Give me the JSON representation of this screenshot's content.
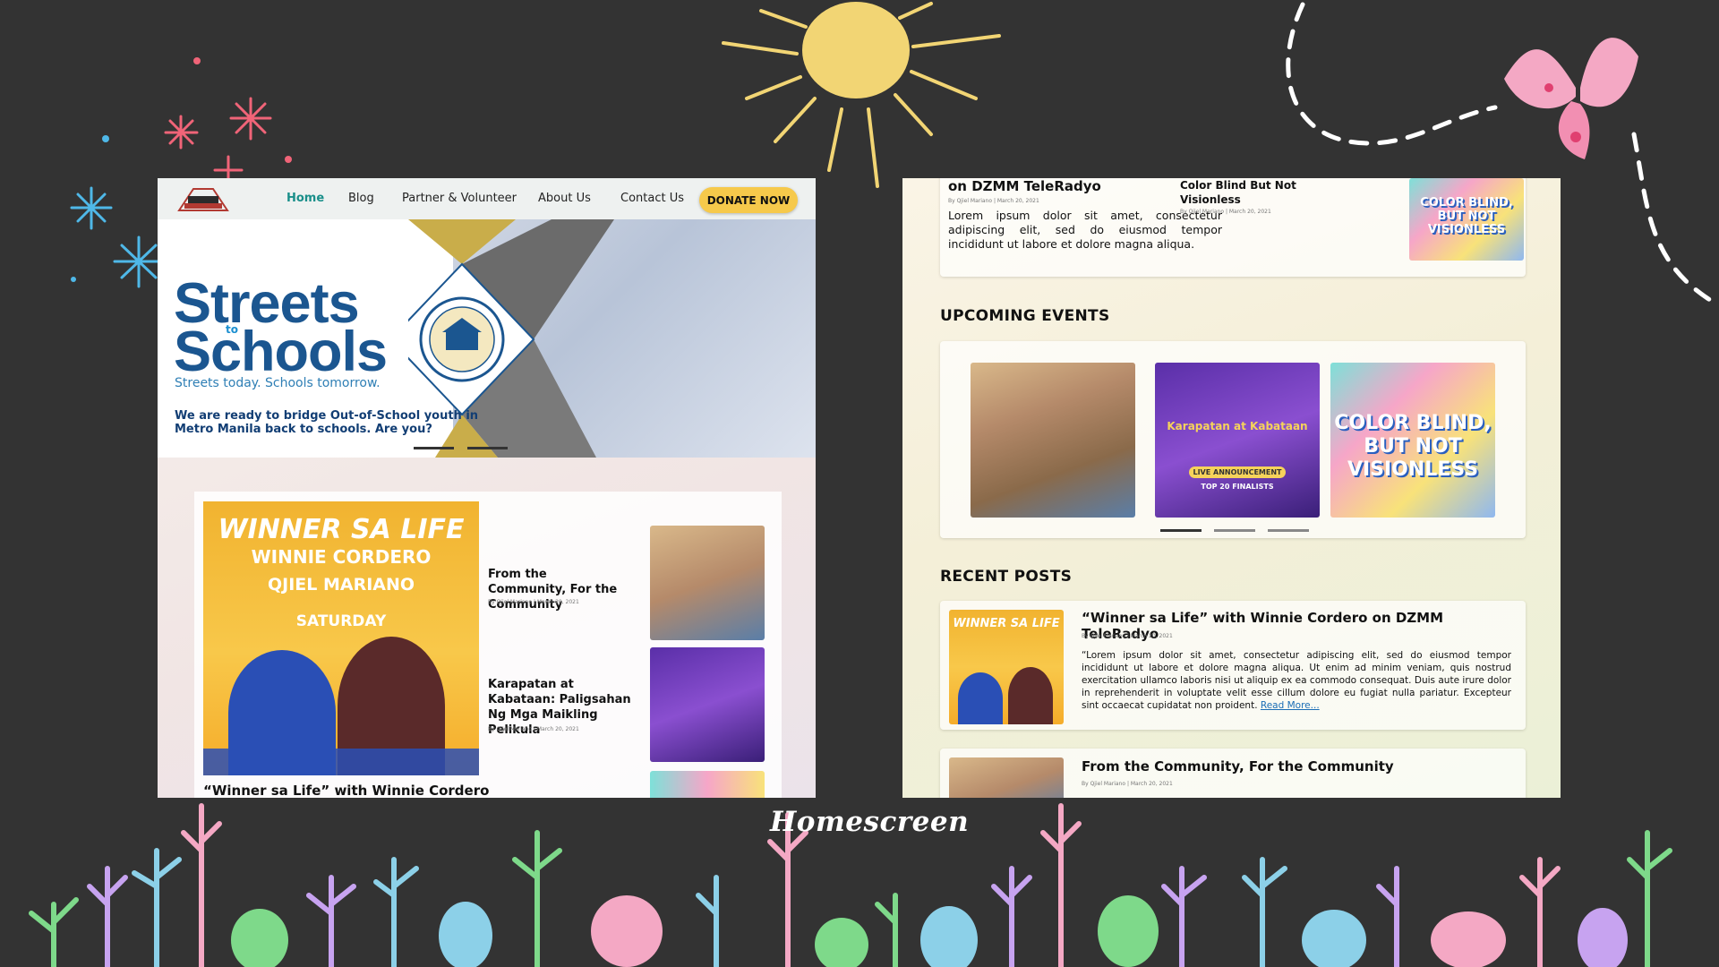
{
  "caption": "Homescreen",
  "nav": {
    "logo_text": "WORD STREET",
    "items": [
      "Home",
      "Blog",
      "Partner & Volunteer",
      "About Us",
      "Contact Us"
    ],
    "donate": "DONATE NOW"
  },
  "hero": {
    "title_line1": "Streets",
    "title_to": "to",
    "title_line2": "Schools",
    "tagline": "Streets today. Schools tomorrow.",
    "subtitle": "We are ready to bridge Out-of-School youth in Metro Manila back to schools. Are you?"
  },
  "featured": {
    "image_lines": [
      "WINNER SA LIFE",
      "WINNIE CORDERO",
      "QJIEL MARIANO",
      "SATURDAY"
    ],
    "caption": "“Winner sa Life” with Winnie Cordero"
  },
  "side_posts": [
    {
      "title": "From the Community, For the Community",
      "meta": "By Qjiel Mariano | March 20, 2021"
    },
    {
      "title": "Karapatan at Kabataan: Paligsahan Ng Mga Maikling Pelikula",
      "meta": "By Qjiel Mariano | March 20, 2021"
    }
  ],
  "right_top": {
    "title": "on DZMM TeleRadyo",
    "meta": "By Qjiel Mariano | March 20, 2021",
    "excerpt": "Lorem ipsum dolor sit amet, consectetur adipiscing elit, sed do eiusmod tempor incididunt ut labore et dolore magna aliqua.",
    "side_title": "Color Blind But Not Visionless",
    "side_meta": "By Qjiel Mariano | March 20, 2021"
  },
  "upcoming": {
    "heading": "UPCOMING EVENTS",
    "events": [
      {
        "label": ""
      },
      {
        "label": "Karapatan at Kabataan",
        "sub": "LIVE ANNOUNCEMENT",
        "sub2": "TOP 20 FINALISTS"
      },
      {
        "label": "COLOR BLIND, BUT NOT VISIONLESS"
      }
    ]
  },
  "recent": {
    "heading": "RECENT  POSTS",
    "posts": [
      {
        "title": "“Winner sa Life” with Winnie Cordero on DZMM TeleRadyo",
        "meta": "By Qjiel Mariano | March 20, 2021",
        "excerpt": "“Lorem ipsum dolor sit amet, consectetur adipiscing elit, sed do eiusmod tempor incididunt ut labore et dolore magna aliqua. Ut enim ad minim veniam, quis nostrud exercitation ullamco laboris nisi ut aliquip ex ea commodo consequat. Duis aute irure dolor in reprehenderit in voluptate velit esse cillum dolore eu fugiat nulla pariatur. Excepteur sint occaecat cupidatat non proident.",
        "read_more": "Read More..."
      },
      {
        "title": "From the Community, For the Community",
        "meta": "By Qjiel Mariano | March 20, 2021"
      }
    ]
  }
}
